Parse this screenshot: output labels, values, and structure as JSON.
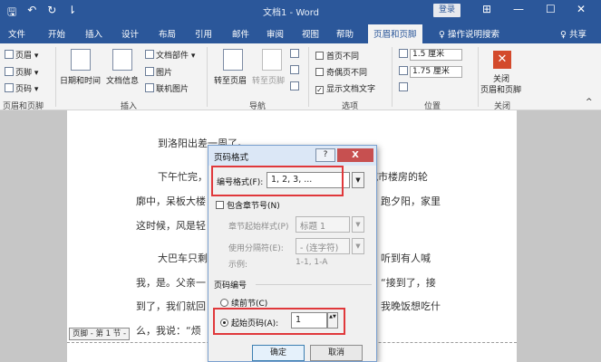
{
  "titlebar": {
    "title": "文档1 - Word",
    "login": "登录",
    "qat": {
      "save": "🖫",
      "undo": "↶",
      "redo": "↻",
      "customize": "⇂"
    },
    "ctrl": {
      "ribbon": "⊞",
      "min": "—",
      "max": "☐",
      "close": "✕"
    }
  },
  "tabs": [
    "文件",
    "开始",
    "插入",
    "设计",
    "布局",
    "引用",
    "邮件",
    "审阅",
    "视图",
    "帮助",
    "页眉和页脚"
  ],
  "active_tab": "页眉和页脚",
  "tellme": "♀ 操作说明搜索",
  "share": "♀ 共享",
  "ribbon": {
    "header": "页眉 ▾",
    "footer": "页脚 ▾",
    "page_number": "页码 ▾",
    "group_header_footer": "页眉和页脚",
    "date_time": "日期和时间",
    "doc_info": "文档信息",
    "doc_parts": "文档部件 ▾",
    "picture": "图片",
    "online_picture": "联机图片",
    "group_insert": "插入",
    "goto_header": "转至页眉",
    "goto_footer": "转至页脚",
    "group_nav": "导航",
    "diff_first": "首页不同",
    "diff_odd_even": "奇偶页不同",
    "show_doc_text": "显示文档文字",
    "group_options": "选项",
    "header_pos": "1.5 厘米",
    "footer_pos": "1.75 厘米",
    "group_position": "位置",
    "close_label_1": "关闭",
    "close_label_2": "页眉和页脚",
    "group_close": "关闭",
    "collapse": "^"
  },
  "document": {
    "line1": "到洛阳出差一周了。",
    "line2a": "下午忙完，",
    "line2b": "城市楼房的轮",
    "line3a": "廓中，呆板大楼",
    "line3b": "跑夕阳，家里",
    "line4a": "这时候，风是轻",
    "line5a": "大巴车只剩",
    "line5b": "听到有人喊",
    "line6a": "我，是。父亲一",
    "line6b": "“接到了，接",
    "line7a": "到了，我们就回",
    "line7b": "我晚饭想吃什",
    "line8a": "么，我说：“烦",
    "footer_tag": "页脚 - 第 1 节 -"
  },
  "dialog": {
    "title": "页码格式",
    "help": "?",
    "close": "X",
    "number_format_label": "编号格式(F):",
    "number_format_value": "1, 2, 3, ...",
    "include_chapter": "包含章节号(N)",
    "chapter_style_label": "章节起始样式(P)",
    "chapter_style_value": "标题 1",
    "separator_label": "使用分隔符(E):",
    "separator_value": "- (连字符)",
    "example_label": "示例:",
    "example_value": "1-1, 1-A",
    "page_numbering": "页码编号",
    "continue_prev": "续前节(C)",
    "start_at": "起始页码(A):",
    "start_value": "1",
    "ok": "确定",
    "cancel": "取消",
    "dropdown_arrow": "▼",
    "spin_arrows": "▲▼"
  }
}
